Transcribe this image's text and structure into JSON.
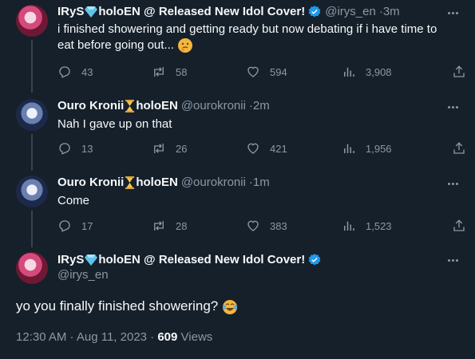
{
  "tweets": [
    {
      "name_a": "IRyS",
      "name_b": "holoEN @ Released New Idol Cover!",
      "handle": "@irys_en",
      "time": "3m",
      "text": "i finished showering and getting ready but now debating if i have time to eat before going out...",
      "emoji": "thinking-face",
      "replies": "43",
      "retweets": "58",
      "likes": "594",
      "views": "3,908"
    },
    {
      "name_a": "Ouro Kronii",
      "name_b": "holoEN",
      "handle": "@ourokronii",
      "time": "2m",
      "text": "Nah I gave up on that",
      "replies": "13",
      "retweets": "26",
      "likes": "421",
      "views": "1,956"
    },
    {
      "name_a": "Ouro Kronii",
      "name_b": "holoEN",
      "handle": "@ourokronii",
      "time": "1m",
      "text": "Come",
      "replies": "17",
      "retweets": "28",
      "likes": "383",
      "views": "1,523"
    }
  ],
  "main": {
    "name_a": "IRyS",
    "name_b": "holoEN @ Released New Idol Cover!",
    "handle": "@irys_en",
    "text": "yo you finally finished showering?",
    "emoji": "face-with-tears-of-joy",
    "timestamp": "12:30 AM · Aug 11, 2023 · ",
    "views_count": "609",
    "views_label": " Views"
  },
  "separator": " · ",
  "colors": {
    "background": "#15202b",
    "text": "#f7f9f9",
    "muted": "#8b98a5",
    "verified": "#1d9bf0"
  }
}
